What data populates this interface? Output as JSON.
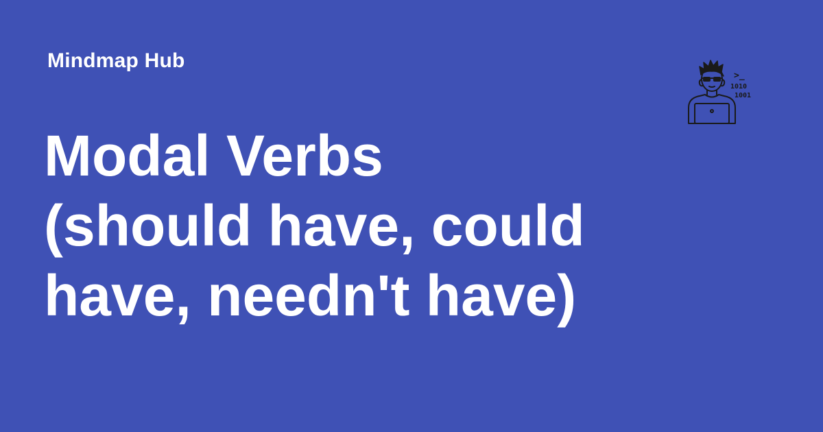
{
  "brand": {
    "name": "Mindmap Hub"
  },
  "title": {
    "lines": [
      "Modal Verbs",
      "(should have, could",
      "have, needn't have)"
    ]
  },
  "illustration": {
    "icon": "hacker-with-laptop-icon",
    "prompt_glyph": ">_",
    "binary_lines": [
      "1010",
      "1001"
    ]
  },
  "colors": {
    "background": "#3f51b5",
    "text": "#ffffff",
    "icon_stroke": "#1a1a1a"
  }
}
